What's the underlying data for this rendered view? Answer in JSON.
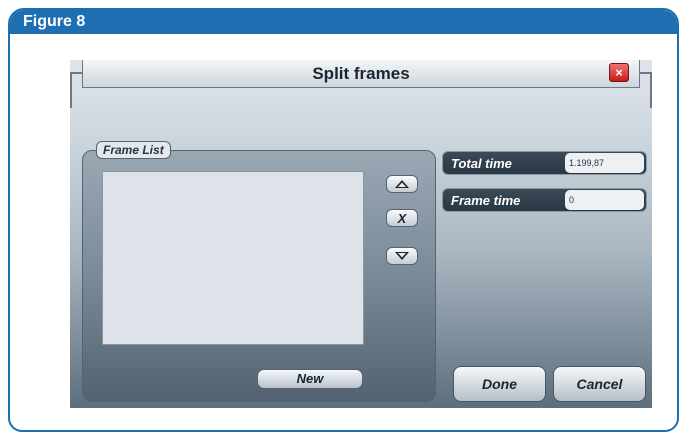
{
  "figure": {
    "label": "Figure 8"
  },
  "window": {
    "title": "Split frames",
    "close_label": "×"
  },
  "frame_list": {
    "legend": "Frame List",
    "items": [],
    "move_up_icon": "triangle-up-icon",
    "delete_label": "X",
    "move_down_icon": "triangle-down-icon",
    "new_label": "New"
  },
  "fields": {
    "total_time": {
      "label": "Total time",
      "value": "1.199,87"
    },
    "frame_time": {
      "label": "Frame time",
      "value": "0"
    }
  },
  "actions": {
    "done_label": "Done",
    "cancel_label": "Cancel"
  },
  "colors": {
    "figure_header": "#1d6fb2",
    "close_button": "#d32626"
  }
}
